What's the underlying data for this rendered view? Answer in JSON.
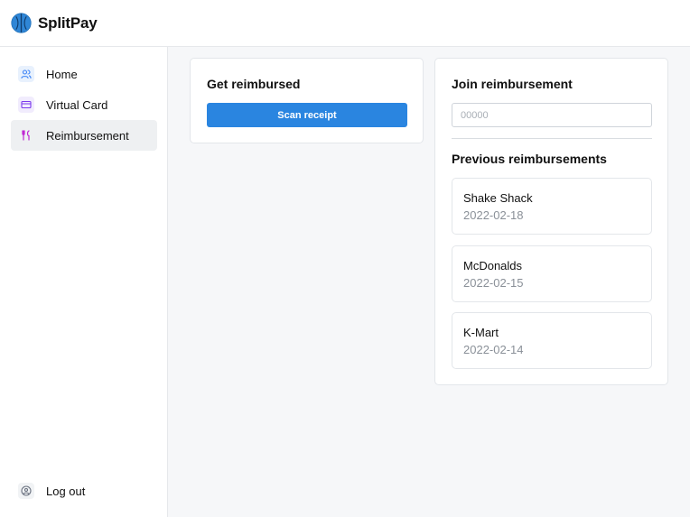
{
  "app": {
    "name": "SplitPay"
  },
  "sidebar": {
    "items": [
      {
        "label": "Home",
        "icon": "users-icon",
        "color": "#3b82f6"
      },
      {
        "label": "Virtual Card",
        "icon": "credit-card-icon",
        "color": "#7c3aed"
      },
      {
        "label": "Reimbursement",
        "icon": "utensils-icon",
        "color": "#c026d3"
      }
    ],
    "active_item": "Reimbursement",
    "logout": {
      "label": "Log out",
      "icon": "user-circle-icon"
    }
  },
  "get_reimbursed": {
    "title": "Get reimbursed",
    "button_label": "Scan receipt"
  },
  "join_reimbursement": {
    "title": "Join reimbursement",
    "input_placeholder": "00000",
    "input_value": ""
  },
  "previous_reimbursements": {
    "title": "Previous reimbursements",
    "items": [
      {
        "name": "Shake Shack",
        "date": "2022-02-18"
      },
      {
        "name": "McDonalds",
        "date": "2022-02-15"
      },
      {
        "name": "K-Mart",
        "date": "2022-02-14"
      }
    ]
  },
  "colors": {
    "accent": "#2a85e0",
    "logo": "#2f86d6"
  }
}
